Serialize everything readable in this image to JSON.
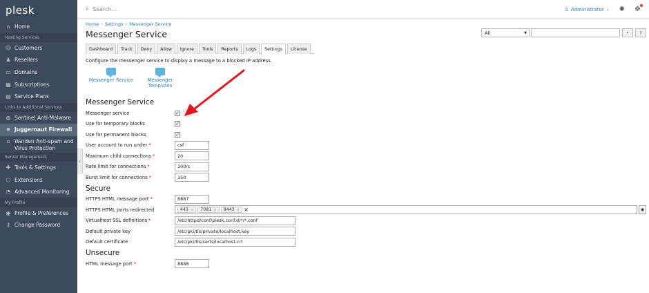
{
  "sidebar": {
    "logo": "plesk",
    "items": [
      {
        "type": "item",
        "label": "Home",
        "icon": "home-icon",
        "glyph": "⌂"
      },
      {
        "type": "section",
        "label": "Hosting Services"
      },
      {
        "type": "item",
        "label": "Customers",
        "icon": "customers-icon",
        "glyph": "☺"
      },
      {
        "type": "item",
        "label": "Resellers",
        "icon": "resellers-icon",
        "glyph": "♟"
      },
      {
        "type": "item",
        "label": "Domains",
        "icon": "domains-icon",
        "glyph": "▭"
      },
      {
        "type": "item",
        "label": "Subscriptions",
        "icon": "subscriptions-icon",
        "glyph": "▦"
      },
      {
        "type": "item",
        "label": "Service Plans",
        "icon": "service-plans-icon",
        "glyph": "▤"
      },
      {
        "type": "section",
        "label": "Links to Additional Services"
      },
      {
        "type": "item",
        "label": "Sentinel Anti-Malware",
        "icon": "sentinel-icon",
        "glyph": "◍"
      },
      {
        "type": "item",
        "label": "Juggernaut Firewall",
        "icon": "firewall-icon",
        "glyph": "✸",
        "active": true
      },
      {
        "type": "item2",
        "label1": "Warden Anti-spam and",
        "label2": "Virus Protection",
        "icon": "warden-icon",
        "glyph": "▫"
      },
      {
        "type": "section",
        "label": "Server Management"
      },
      {
        "type": "item",
        "label": "Tools & Settings",
        "icon": "tools-icon",
        "glyph": "✚"
      },
      {
        "type": "item",
        "label": "Extensions",
        "icon": "extensions-icon",
        "glyph": "⬡"
      },
      {
        "type": "item",
        "label": "Advanced Monitoring",
        "icon": "monitoring-icon",
        "glyph": "◔"
      },
      {
        "type": "section",
        "label": "My Profile"
      },
      {
        "type": "item",
        "label": "Profile & Preferences",
        "icon": "profile-icon",
        "glyph": "◉"
      },
      {
        "type": "item",
        "label": "Change Password",
        "icon": "key-icon",
        "glyph": "⚷"
      }
    ]
  },
  "topbar": {
    "search_placeholder": "Search...",
    "user": "Administrator"
  },
  "breadcrumb": [
    "Home",
    "Settings",
    "Messenger Service"
  ],
  "page_title": "Messenger Service",
  "filter": {
    "select_value": "All"
  },
  "tabs": [
    "Dashboard",
    "Track",
    "Deny",
    "Allow",
    "Ignore",
    "Tools",
    "Reports",
    "Logs",
    "Settings",
    "License"
  ],
  "active_tab": "Settings",
  "description": "Configure the messenger service to display a message to a blocked IP address.",
  "shortcuts": [
    {
      "label1": "Messenger Service",
      "label2": ""
    },
    {
      "label1": "Messenger",
      "label2": "Templates"
    }
  ],
  "sections": {
    "messenger": {
      "title": "Messenger Service",
      "rows": [
        {
          "label": "Messenger service",
          "type": "checkbox",
          "checked": true,
          "required": false
        },
        {
          "label": "Use for temporary blocks",
          "type": "checkbox",
          "checked": true,
          "required": false
        },
        {
          "label": "Use for permanent blocks",
          "type": "checkbox",
          "checked": true,
          "required": false
        },
        {
          "label": "User account to run under",
          "type": "text",
          "value": "csf",
          "required": true,
          "size": "w50"
        },
        {
          "label": "Maximum child connections",
          "type": "text",
          "value": "20",
          "required": true,
          "size": "w50"
        },
        {
          "label": "Rate limit for connections",
          "type": "text",
          "value": "100/s",
          "required": true,
          "size": "w50"
        },
        {
          "label": "Burst limit for connections",
          "type": "text",
          "value": "150",
          "required": true,
          "size": "w50"
        }
      ]
    },
    "secure": {
      "title": "Secure",
      "rows": [
        {
          "label": "HTTPS HTML message port",
          "type": "text",
          "value": "8887",
          "required": true,
          "size": "w50"
        },
        {
          "label": "HTTPS HTML ports redirected",
          "type": "tags",
          "tags": [
            "443",
            "7081",
            "8443"
          ],
          "required": false
        },
        {
          "label": "Virtualhost SSL definitions",
          "type": "text",
          "value": "/etc/httpd/conf/plesk.conf.d/*/*.conf",
          "required": true,
          "size": "w175"
        },
        {
          "label": "Default private key",
          "type": "text",
          "value": "/etc/pki/tls/private/localhost.key",
          "required": false,
          "size": "w175"
        },
        {
          "label": "Default certificate",
          "type": "text",
          "value": "/etc/pki/tls/certs/localhost.crt",
          "required": false,
          "size": "w175"
        }
      ]
    },
    "unsecure": {
      "title": "Unsecure",
      "rows": [
        {
          "label": "HTML message port",
          "type": "text",
          "value": "8888",
          "required": true,
          "size": "w50"
        }
      ]
    }
  },
  "colors": {
    "sidebar": "#3b4a5a",
    "link": "#2f80c5",
    "required": "#d0021b",
    "arrow": "#e2161b"
  }
}
